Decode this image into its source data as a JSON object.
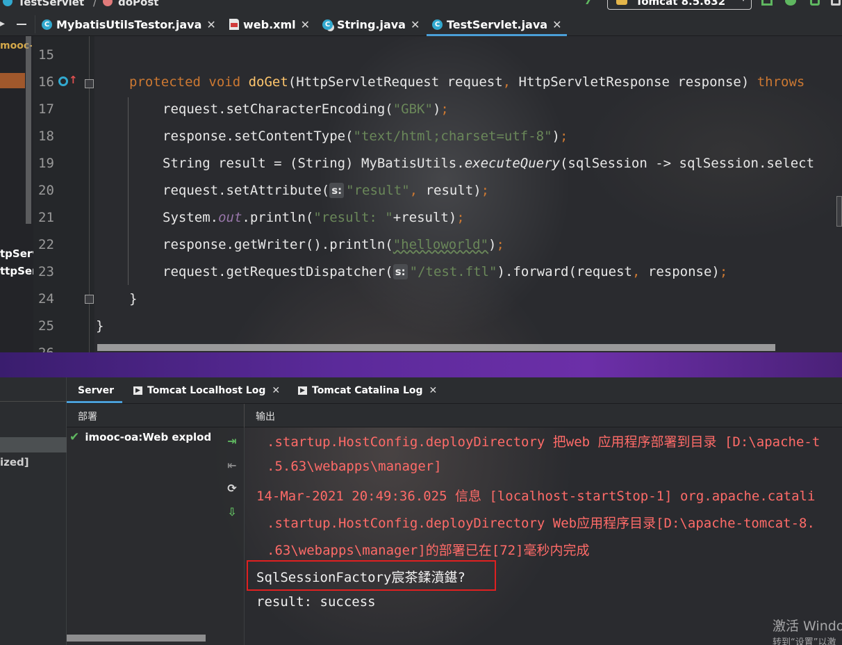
{
  "breadcrumb": {
    "class_name": "TestServlet",
    "separator": "/",
    "method_name": "doPost"
  },
  "run_config": {
    "label": "Tomcat 8.5.632"
  },
  "editor_tabs": [
    {
      "label": "MybatisUtilsTestor.java",
      "icon": "class-icon"
    },
    {
      "label": "web.xml",
      "icon": "xml-file-icon"
    },
    {
      "label": "String.java",
      "icon": "class-locked-icon"
    },
    {
      "label": "TestServlet.java",
      "icon": "class-icon",
      "active": true
    }
  ],
  "left_panel": {
    "fragment_top": "mooc-o",
    "fragment_1": "tpServ",
    "fragment_2": "ttpSer",
    "fragment_3": "ized]"
  },
  "editor": {
    "line_numbers": [
      "15",
      "16",
      "17",
      "18",
      "19",
      "20",
      "21",
      "22",
      "23",
      "24",
      "25",
      "26"
    ],
    "lines": [
      {
        "n": "16",
        "parts": [
          [
            "kw",
            "protected void "
          ],
          [
            "fn",
            "doGet"
          ],
          [
            "",
            "(HttpServletRequest request"
          ],
          [
            "kw",
            ","
          ],
          [
            "",
            " HttpServletResponse response) "
          ],
          [
            "kw",
            "throws"
          ]
        ]
      },
      {
        "n": "17",
        "parts": [
          [
            "",
            "request.setCharacterEncoding("
          ],
          [
            "str",
            "\"GBK\""
          ],
          [
            "",
            ")"
          ],
          [
            "kw",
            ";"
          ]
        ]
      },
      {
        "n": "18",
        "parts": [
          [
            "",
            "response.setContentType("
          ],
          [
            "str",
            "\"text/html;charset=utf-8\""
          ],
          [
            "",
            ")"
          ],
          [
            "kw",
            ";"
          ]
        ]
      },
      {
        "n": "19",
        "parts": [
          [
            "",
            "String result = (String) MyBatisUtils."
          ],
          [
            "it",
            "executeQuery"
          ],
          [
            "",
            "(sqlSession -> sqlSession.select"
          ]
        ]
      },
      {
        "n": "20",
        "parts": [
          [
            "",
            "request.setAttribute("
          ],
          [
            "hint",
            "s:"
          ],
          [
            "str",
            "\"result\""
          ],
          [
            "kw",
            ","
          ],
          [
            "",
            " result)"
          ],
          [
            "kw",
            ";"
          ]
        ]
      },
      {
        "n": "21",
        "parts": [
          [
            "",
            "System."
          ],
          [
            "pur",
            "out"
          ],
          [
            "",
            ".println("
          ],
          [
            "str",
            "\"result: \""
          ],
          [
            "",
            "+result)"
          ],
          [
            "kw",
            ";"
          ]
        ]
      },
      {
        "n": "22",
        "parts": [
          [
            "",
            "response.getWriter().println("
          ],
          [
            "str",
            "\"helloworld\""
          ],
          [
            "",
            ")"
          ],
          [
            "kw",
            ";"
          ]
        ]
      },
      {
        "n": "23",
        "parts": [
          [
            "",
            "request.getRequestDispatcher("
          ],
          [
            "hint",
            "s:"
          ],
          [
            "str",
            "\"/test.ftl\""
          ],
          [
            "",
            ").forward(request"
          ],
          [
            "kw",
            ","
          ],
          [
            "",
            " response)"
          ],
          [
            "kw",
            ";"
          ]
        ]
      },
      {
        "n": "24",
        "parts": [
          [
            "",
            "}"
          ]
        ]
      },
      {
        "n": "25",
        "parts": [
          [
            "",
            "}"
          ]
        ]
      }
    ]
  },
  "services": {
    "tabs": [
      {
        "label": "Server",
        "active": true
      },
      {
        "label": "Tomcat Localhost Log",
        "closable": true
      },
      {
        "label": "Tomcat Catalina Log",
        "closable": true
      }
    ],
    "col_deploy": "部署",
    "col_output": "输出",
    "deployment_item": "imooc-oa:Web explod",
    "log_lines": [
      ".startup.HostConfig.deployDirectory 把web 应用程序部署到目录 [D:\\apache-t",
      ".5.63\\webapps\\manager]",
      "14-Mar-2021 20:49:36.025 信息 [localhost-startStop-1] org.apache.catali",
      ".startup.HostConfig.deployDirectory Web应用程序目录[D:\\apache-tomcat-8.",
      ".63\\webapps\\manager]的部署已在[72]毫秒内完成"
    ],
    "output_lines": [
      "SqlSessionFactory宸茶鍒濆鍖?",
      "result: success"
    ]
  },
  "watermark": {
    "line1": "激活 Windo",
    "line2": "转到“设置”以激"
  },
  "colors": {
    "keyword": "#cc7832",
    "method": "#ffc66d",
    "string": "#6a8759",
    "error_log": "#ff6b68",
    "highlight_box": "#e02020",
    "tab_underline": "#4a9fd8"
  }
}
